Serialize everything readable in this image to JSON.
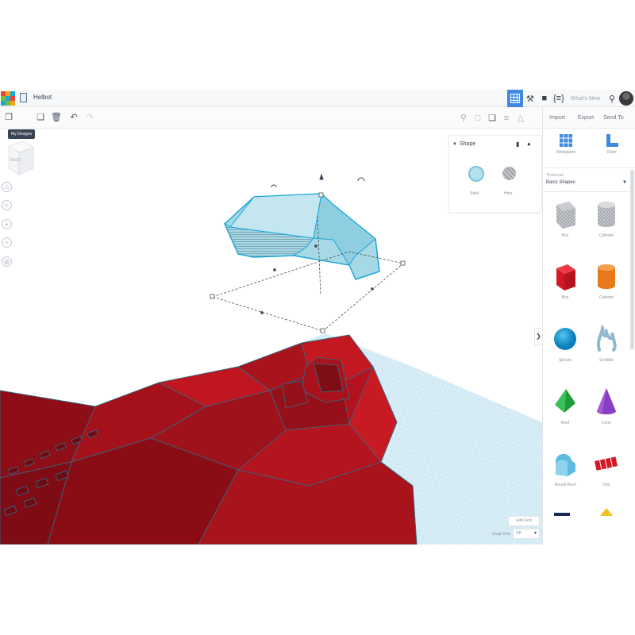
{
  "app": {
    "design_name": "Helbot",
    "whats_new": "What's New",
    "tooltip": "My Designs"
  },
  "toolbar": {
    "import": "Import",
    "export": "Export",
    "send_to": "Send To"
  },
  "viewcube": {
    "face_label": "BACK"
  },
  "inspector": {
    "title": "Shape",
    "solid_label": "Solid",
    "hole_label": "Hole",
    "solid_color": "#b4e1ee",
    "hole_color": "#a6a9ad"
  },
  "grid": {
    "edit_grid": "Edit Grid",
    "snap_label": "Snap Grid",
    "snap_value": "Off"
  },
  "right_panel": {
    "tools": [
      {
        "label": "Workplane",
        "icon": "workplane-icon"
      },
      {
        "label": "Ruler",
        "icon": "ruler-icon"
      }
    ],
    "library_small": "Tinkercad",
    "library_value": "Basic Shapes",
    "shapes": [
      {
        "label": "Box",
        "icon": "box-hole-icon"
      },
      {
        "label": "Cylinder",
        "icon": "cylinder-hole-icon"
      },
      {
        "label": "Box",
        "icon": "box-icon"
      },
      {
        "label": "Cylinder",
        "icon": "cylinder-icon"
      },
      {
        "label": "Sphere",
        "icon": "sphere-icon"
      },
      {
        "label": "Scribble",
        "icon": "scribble-icon"
      },
      {
        "label": "Roof",
        "icon": "roof-icon"
      },
      {
        "label": "Cone",
        "icon": "cone-icon"
      },
      {
        "label": "Round Roof",
        "icon": "round-roof-icon"
      },
      {
        "label": "Text",
        "icon": "text-icon"
      }
    ]
  },
  "colors": {
    "selection": "#1aa7d8",
    "model_red": "#b5141f",
    "workplane": "#cfe8f3",
    "accent_blue": "#3e8ae0"
  }
}
